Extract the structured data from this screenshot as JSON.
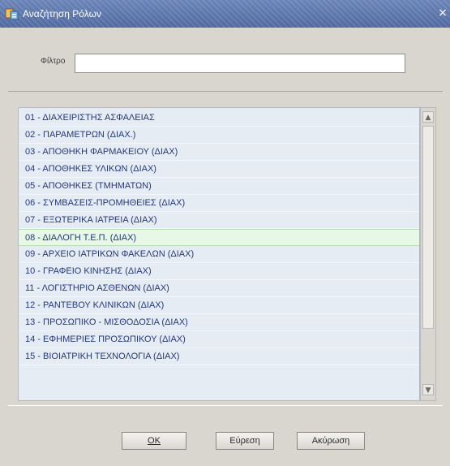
{
  "window": {
    "title": "Αναζήτηση Ρόλων",
    "close_glyph": "×"
  },
  "filter": {
    "label": "Φίλτρο",
    "value": "",
    "placeholder": ""
  },
  "list": {
    "selected_index": 7,
    "items": [
      "01 - ΔΙΑΧΕΙΡΙΣΤΗΣ ΑΣΦΑΛΕΙΑΣ",
      "02 - ΠΑΡΑΜΕΤΡΩΝ (ΔΙΑΧ.)",
      "03 - ΑΠΟΘΗΚΗ ΦΑΡΜΑΚΕΙΟΥ (ΔΙΑΧ)",
      "04 - ΑΠΟΘΗΚΕΣ ΥΛΙΚΩΝ (ΔΙΑΧ)",
      "05 - ΑΠΟΘΗΚΕΣ (ΤΜΗΜΑΤΩΝ)",
      "06 - ΣΥΜΒΑΣΕΙΣ-ΠΡΟΜΗΘΕΙΕΣ (ΔΙΑΧ)",
      "07 - ΕΞΩΤΕΡΙΚΑ ΙΑΤΡΕΙΑ (ΔΙΑΧ)",
      "08 - ΔΙΑΛΟΓΗ Τ.Ε.Π. (ΔΙΑΧ)",
      "09 - ΑΡΧΕΙΟ ΙΑΤΡΙΚΩΝ ΦΑΚΕΛΩΝ (ΔΙΑΧ)",
      "10 - ΓΡΑΦΕΙΟ ΚΙΝΗΣΗΣ (ΔΙΑΧ)",
      "11 - ΛΟΓΙΣΤΗΡΙΟ ΑΣΘΕΝΩΝ (ΔΙΑΧ)",
      "12 - ΡΑΝΤΕΒΟΥ ΚΛΙΝΙΚΩΝ (ΔΙΑΧ)",
      "13 - ΠΡΟΣΩΠΙΚΟ - ΜΙΣΘΟΔΟΣΙΑ (ΔΙΑΧ)",
      "14 - ΕΦΗΜΕΡΙΕΣ ΠΡΟΣΩΠΙΚΟΥ (ΔΙΑΧ)",
      "15 - ΒΙΟΙΑΤΡΙΚΗ ΤΕΧΝΟΛΟΓΙΑ (ΔΙΑΧ)"
    ]
  },
  "scrollbar": {
    "up_glyph": "▲",
    "down_glyph": "▼"
  },
  "buttons": {
    "ok": "OK",
    "find": "Εύρεση",
    "cancel": "Ακύρωση"
  },
  "icons": {
    "window_icon": "app-window-icon",
    "close": "close-icon"
  },
  "colors": {
    "titlebar": "#5a73a8",
    "list_background": "#e6ecf4",
    "list_text": "#23387a",
    "selected_row": "#e8f8e6"
  }
}
